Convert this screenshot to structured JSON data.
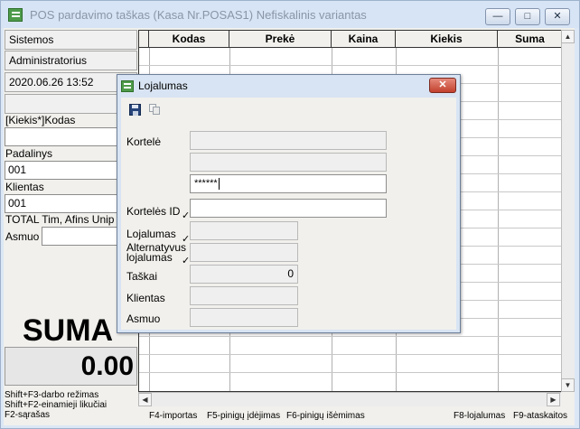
{
  "window": {
    "title": "POS pardavimo taškas (Kasa Nr.POSAS1) Nefiskalinis variantas"
  },
  "left_panel": {
    "sistemos": "Sistemos",
    "user": "Administratorius",
    "datetime": "2020.06.26 13:52",
    "qty_code_label": "[Kiekis*]Kodas",
    "qty_code_value": "",
    "padalinys_label": "Padalinys",
    "padalinys_value": "001",
    "klientas_label": "Klientas",
    "klientas_value": "001",
    "client_name": "TOTAL Tim, Afins Unip",
    "asmuo_label": "Asmuo",
    "asmuo_value": "",
    "suma_label": "SUMA",
    "suma_value": "0.00"
  },
  "grid": {
    "columns": [
      "Kodas",
      "Prekė",
      "Kaina",
      "Kiekis",
      "Suma"
    ],
    "rows": []
  },
  "status_bar": {
    "left_lines": [
      "Shift+F3-darbo režimas",
      "Shift+F2-einamieji likučiai",
      "F2-sąrašas"
    ],
    "f4": "F4-importas",
    "f5": "F5-pinigų įdėjimas",
    "f6": "F6-pinigų išėmimas",
    "f8": "F8-lojalumas",
    "f9": "F9-ataskaitos"
  },
  "dialog": {
    "title": "Lojalumas",
    "toolbar_icons": [
      "save-icon",
      "copy-icon"
    ],
    "kortele_label": "Kortelė",
    "kortele_line1": "",
    "kortele_line2": "",
    "kortele_pin": "******",
    "korteles_id_label": "Kortelės ID",
    "korteles_id_value": "",
    "lojalumas_label": "Lojalumas",
    "lojalumas_value": "",
    "alternatyvus_label_1": "Alternatyvus",
    "alternatyvus_label_2": "lojalumas",
    "alternatyvus_value": "",
    "taskai_label": "Taškai",
    "taskai_value": "0",
    "klientas_label": "Klientas",
    "klientas_value": "",
    "asmuo_label": "Asmuo",
    "asmuo_value": ""
  }
}
